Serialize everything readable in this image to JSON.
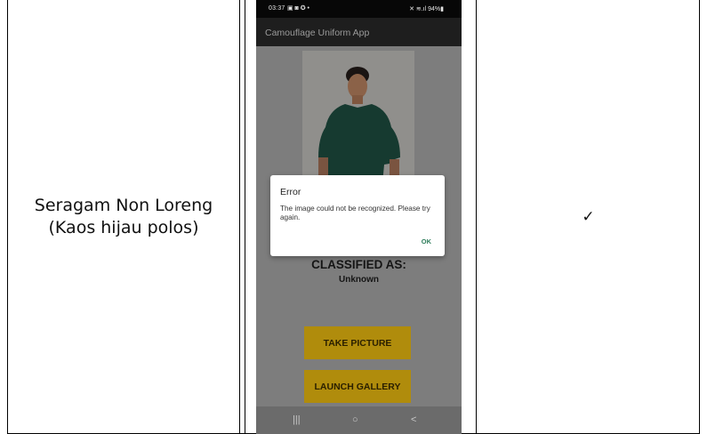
{
  "left_cell": {
    "line1": "Seragam Non Loreng",
    "line2": "(Kaos hijau polos)"
  },
  "right_cell": {
    "result": "✓"
  },
  "phone": {
    "status": {
      "time": "03:37",
      "left_icons": "▣ ◙ ✪ •",
      "right_text": "✕ ≋.ıl 94%▮"
    },
    "app_title": "Camouflage Uniform App",
    "classified_label": "CLASSIFIED AS:",
    "classified_value": "Unknown",
    "take_picture_label": "TAKE PICTURE",
    "launch_gallery_label": "LAUNCH GALLERY",
    "nav": {
      "recents": "|||",
      "home": "○",
      "back": "<"
    },
    "dialog": {
      "title": "Error",
      "message": "The image could not be recognized. Please try again.",
      "ok_label": "OK"
    }
  },
  "colors": {
    "dim_background": "#7d7d7d",
    "button_bg": "#b08c0c",
    "shirt": "#163a30",
    "ok_text": "#2e7d5b"
  }
}
